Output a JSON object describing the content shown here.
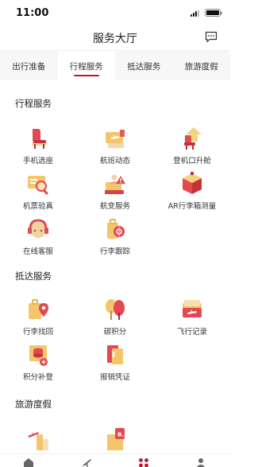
{
  "status": {
    "time": "11:00"
  },
  "nav": {
    "title": "服务大厅",
    "chat_icon": "chat-bubble-icon"
  },
  "tabs": [
    {
      "label": "出行准备",
      "active": false
    },
    {
      "label": "行程服务",
      "active": true
    },
    {
      "label": "抵达服务",
      "active": false
    },
    {
      "label": "旅游度假",
      "active": false
    }
  ],
  "sections": [
    {
      "title": "行程服务",
      "items": [
        {
          "label": "手机选座",
          "icon": "seat-icon"
        },
        {
          "label": "航班动态",
          "icon": "flight-status-icon"
        },
        {
          "label": "登机口升舱",
          "icon": "upgrade-seat-icon"
        },
        {
          "label": "机票验真",
          "icon": "ticket-verify-icon"
        },
        {
          "label": "航变服务",
          "icon": "flight-change-icon"
        },
        {
          "label": "AR行李箱测量",
          "icon": "ar-luggage-icon"
        },
        {
          "label": "在线客服",
          "icon": "customer-service-icon"
        },
        {
          "label": "行李跟踪",
          "icon": "luggage-track-icon"
        }
      ]
    },
    {
      "title": "抵达服务",
      "items": [
        {
          "label": "行李找回",
          "icon": "luggage-recover-icon"
        },
        {
          "label": "碳积分",
          "icon": "carbon-points-icon"
        },
        {
          "label": "飞行记录",
          "icon": "flight-record-icon"
        },
        {
          "label": "积分补登",
          "icon": "points-claim-icon"
        },
        {
          "label": "报销凭证",
          "icon": "receipt-icon"
        }
      ]
    },
    {
      "title": "旅游度假",
      "items": [
        {
          "label": "",
          "icon": "travel-city-icon"
        },
        {
          "label": "",
          "icon": "hotel-icon"
        }
      ]
    }
  ],
  "colors": {
    "accent": "#c8102e",
    "gold": "#e9b24d",
    "red": "#d9404a"
  }
}
